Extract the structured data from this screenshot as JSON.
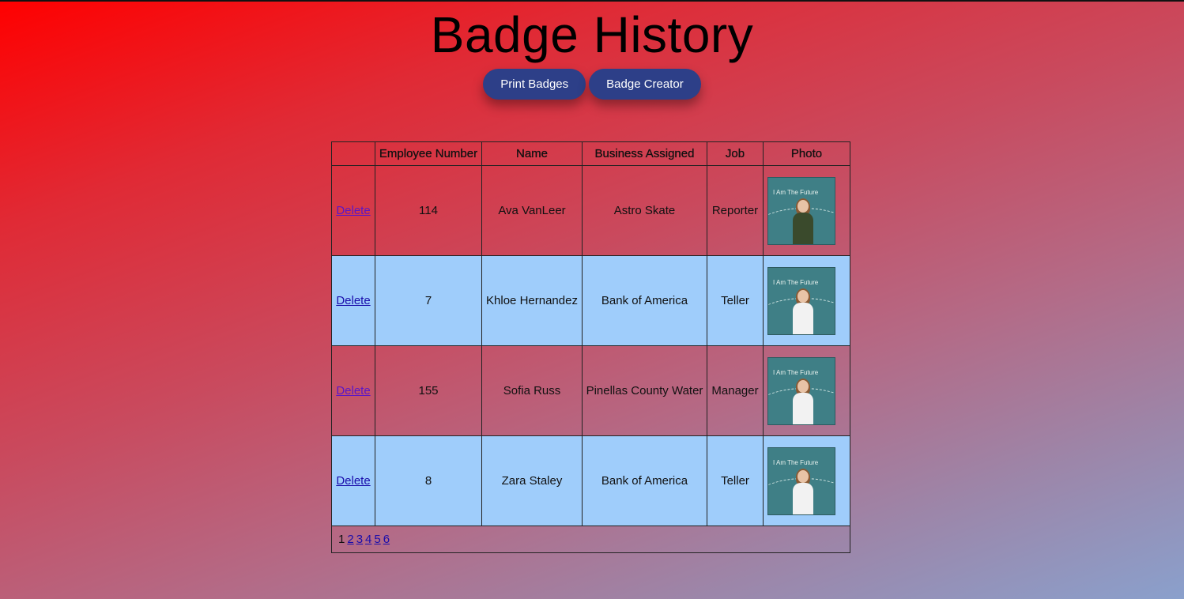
{
  "page": {
    "title": "Badge History"
  },
  "toolbar": {
    "print_label": "Print Badges",
    "creator_label": "Badge Creator"
  },
  "table": {
    "headers": [
      "",
      "Employee Number",
      "Name",
      "Business Assigned",
      "Job",
      "Photo"
    ],
    "delete_label": "Delete",
    "rows": [
      {
        "employee_number": "114",
        "name": "Ava VanLeer",
        "business": "Astro Skate",
        "job": "Reporter",
        "photo_caption": "I Am The Future"
      },
      {
        "employee_number": "7",
        "name": "Khloe Hernandez",
        "business": "Bank of America",
        "job": "Teller",
        "photo_caption": "I Am The Future"
      },
      {
        "employee_number": "155",
        "name": "Sofia Russ",
        "business": "Pinellas County Water",
        "job": "Manager",
        "photo_caption": "I Am The Future"
      },
      {
        "employee_number": "8",
        "name": "Zara Staley",
        "business": "Bank of America",
        "job": "Teller",
        "photo_caption": "I Am The Future"
      }
    ]
  },
  "pagination": {
    "current": "1",
    "pages": [
      "2",
      "3",
      "4",
      "5",
      "6"
    ]
  },
  "colors": {
    "button": "#2d3f88",
    "row_highlight": "#9fcdfb",
    "link": "#1a0dab"
  }
}
